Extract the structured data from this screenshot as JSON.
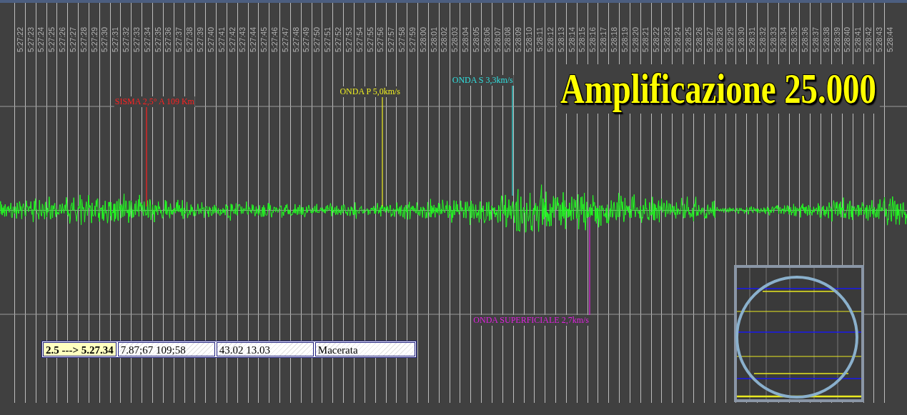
{
  "time_labels": [
    "5:27:22",
    "5:27:23",
    "5:27:24",
    "5:27:25",
    "5:27:26",
    "5:27:27",
    "5:27:28",
    "5:27:29",
    "5:27:30",
    "5:27:31",
    "5:27:32",
    "5:27:33",
    "5:27:34",
    "5:27:35",
    "5:27:36",
    "5:27:37",
    "5:27:38",
    "5:27:39",
    "5:27:40",
    "5:27:41",
    "5:27:42",
    "5:27:43",
    "5:27:44",
    "5:27:45",
    "5:27:46",
    "5:27:47",
    "5:27:48",
    "5:27:49",
    "5:27:50",
    "5:27:51",
    "5:27:52",
    "5:27:53",
    "5:27:54",
    "5:27:55",
    "5:27:56",
    "5:27:57",
    "5:27:58",
    "5:27:59",
    "5:28:00",
    "5:28:01",
    "5:28:02",
    "5:28:03",
    "5:28:04",
    "5:28:05",
    "5:28:06",
    "5:28:07",
    "5:28:08",
    "5:28:09",
    "5:28:10",
    "5:28:11",
    "5:28:12",
    "5:28:13",
    "5:28:14",
    "5:28:15",
    "5:28:16",
    "5:28:17",
    "5:28:18",
    "5:28:19",
    "5:28:20",
    "5:28:21",
    "5:28:22",
    "5:28:23",
    "5:28:24",
    "5:28:25",
    "5:28:26",
    "5:28:27",
    "5:28:28",
    "5:28:29",
    "5:28:30",
    "5:28:31",
    "5:28:32",
    "5:28:33",
    "5:28:34",
    "5:28:35",
    "5:28:36",
    "5:28:37",
    "5:28:38",
    "5:28:39",
    "5:28:40",
    "5:28:41",
    "5:28:42",
    "5:28:43",
    "5:28:44"
  ],
  "title": "Amplificazione 25.000",
  "markers": [
    {
      "kind": "above",
      "label": "SISMA 2,5° A 109 Km",
      "color": "#ff2020"
    },
    {
      "kind": "above",
      "label": "ONDA P 5,0km/s",
      "color": "#f0f020"
    },
    {
      "kind": "above",
      "label": "ONDA S 3,3km/s",
      "color": "#30e0e0"
    },
    {
      "kind": "below",
      "label": "ONDA SUPERFICIALE 2,7km/s",
      "color": "#e020e0"
    }
  ],
  "info_cells": [
    {
      "text": "2.5 ---> 5.27.34",
      "highlighted": true
    },
    {
      "text": "7.87;67 109;58",
      "highlighted": false
    },
    {
      "text": "43.02 13.03",
      "highlighted": false
    },
    {
      "text": "Macerata",
      "highlighted": false
    }
  ]
}
